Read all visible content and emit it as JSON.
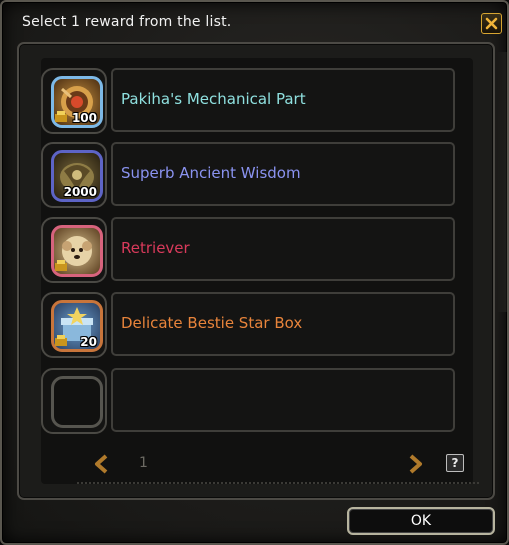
{
  "dialog": {
    "title": "Select 1 reward from the list.",
    "ok_label": "OK",
    "help_label": "?",
    "page_number": "1",
    "close_icon": "close-icon"
  },
  "rewards": [
    {
      "name": "Pakiha's Mechanical Part",
      "quantity": "100",
      "color": "#8fe0df",
      "icon": "mechanical-part-icon",
      "frame": "blue"
    },
    {
      "name": "Superb Ancient Wisdom",
      "quantity": "2000",
      "color": "#8a93f0",
      "icon": "ancient-wisdom-icon",
      "frame": "purple"
    },
    {
      "name": "Retriever",
      "quantity": "",
      "color": "#d93a5b",
      "icon": "retriever-pet-icon",
      "frame": "pink"
    },
    {
      "name": "Delicate Bestie Star Box",
      "quantity": "20",
      "color": "#e8843b",
      "icon": "star-box-icon",
      "frame": "orange"
    },
    {
      "name": "",
      "quantity": "",
      "color": "",
      "icon": "",
      "frame": "empty"
    }
  ]
}
